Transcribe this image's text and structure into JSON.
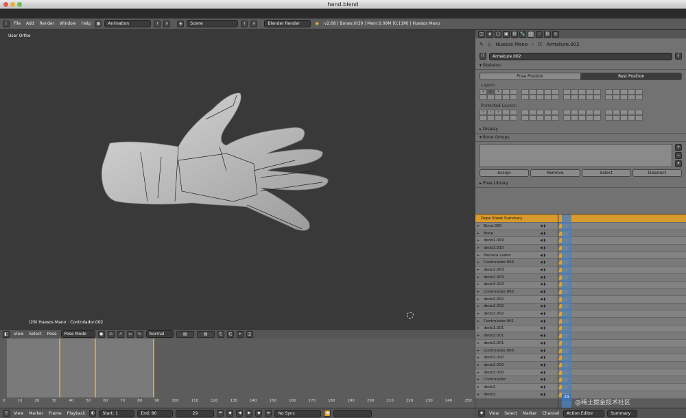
{
  "window": {
    "title": "hand.blend"
  },
  "menubar": {
    "menus": [
      "File",
      "Add",
      "Render",
      "Window",
      "Help"
    ],
    "layout": "Animation",
    "scene": "Scene",
    "engine": "Blender Render",
    "status": "v2.68 | Bones:0/30 | Mem:0.09M (0.11M) | Huesos Mano"
  },
  "viewport": {
    "view_label": "User Ortho",
    "object_info": "(29) Huesos Mano : Controlador.002"
  },
  "viewport_header": {
    "menus": [
      "View",
      "Select",
      "Pose"
    ],
    "mode": "Pose Mode",
    "pivot": "Normal"
  },
  "properties": {
    "breadcrumb_object": "Huesos Mano",
    "breadcrumb_armature": "Armature.002",
    "armature_name": "Armature.002",
    "fake_user": "F",
    "skeleton": "Skeleton",
    "pose_position": "Pose Position",
    "rest_position": "Rest Position",
    "layers_label": "Layers:",
    "protected_label": "Protected Layers:",
    "display": "Display",
    "bone_groups": "Bone Groups",
    "assign": "Assign",
    "remove": "Remove",
    "select": "Select",
    "deselect": "Deselect",
    "pose_library": "Pose Library"
  },
  "dopesheet": {
    "summary": "Dope Sheet Summary",
    "channels": [
      "Bone.000",
      "Bone",
      "dedo1.009",
      "dedo1.010",
      "Muneca Lados",
      "Controlador.003",
      "dedo1.003",
      "dedo2.003",
      "dedo3.003",
      "Controlador.002",
      "dedo1.002",
      "dedo2.002",
      "dedo3.002",
      "Controlador.001",
      "dedo1.001",
      "dedo2.001",
      "dedo3.001",
      "Controlador.000",
      "dedo1.000",
      "dedo2.000",
      "dedo3.000",
      "Controlador",
      "dedo1",
      "dedo2"
    ],
    "current_frame": "29",
    "menus": [
      "View",
      "Select",
      "Marker",
      "Channel"
    ],
    "mode": "Action Editor",
    "summary_btn": "Summary"
  },
  "timeline": {
    "ticks": [
      "0",
      "10",
      "20",
      "30",
      "40",
      "50",
      "60",
      "70",
      "80",
      "90",
      "100",
      "110",
      "120",
      "130",
      "140",
      "150",
      "160",
      "170",
      "180",
      "190",
      "200",
      "210",
      "220",
      "230",
      "240",
      "250"
    ]
  },
  "bottombar": {
    "menus": [
      "View",
      "Marker",
      "Frame",
      "Playback"
    ],
    "start": "Start: 1",
    "end": "End: 80",
    "frame": "29",
    "sync": "No Sync"
  },
  "watermark": "@稀土掘金技术社区",
  "colors": {
    "accent": "#e8a020",
    "selected_row": "#d89a2c"
  }
}
